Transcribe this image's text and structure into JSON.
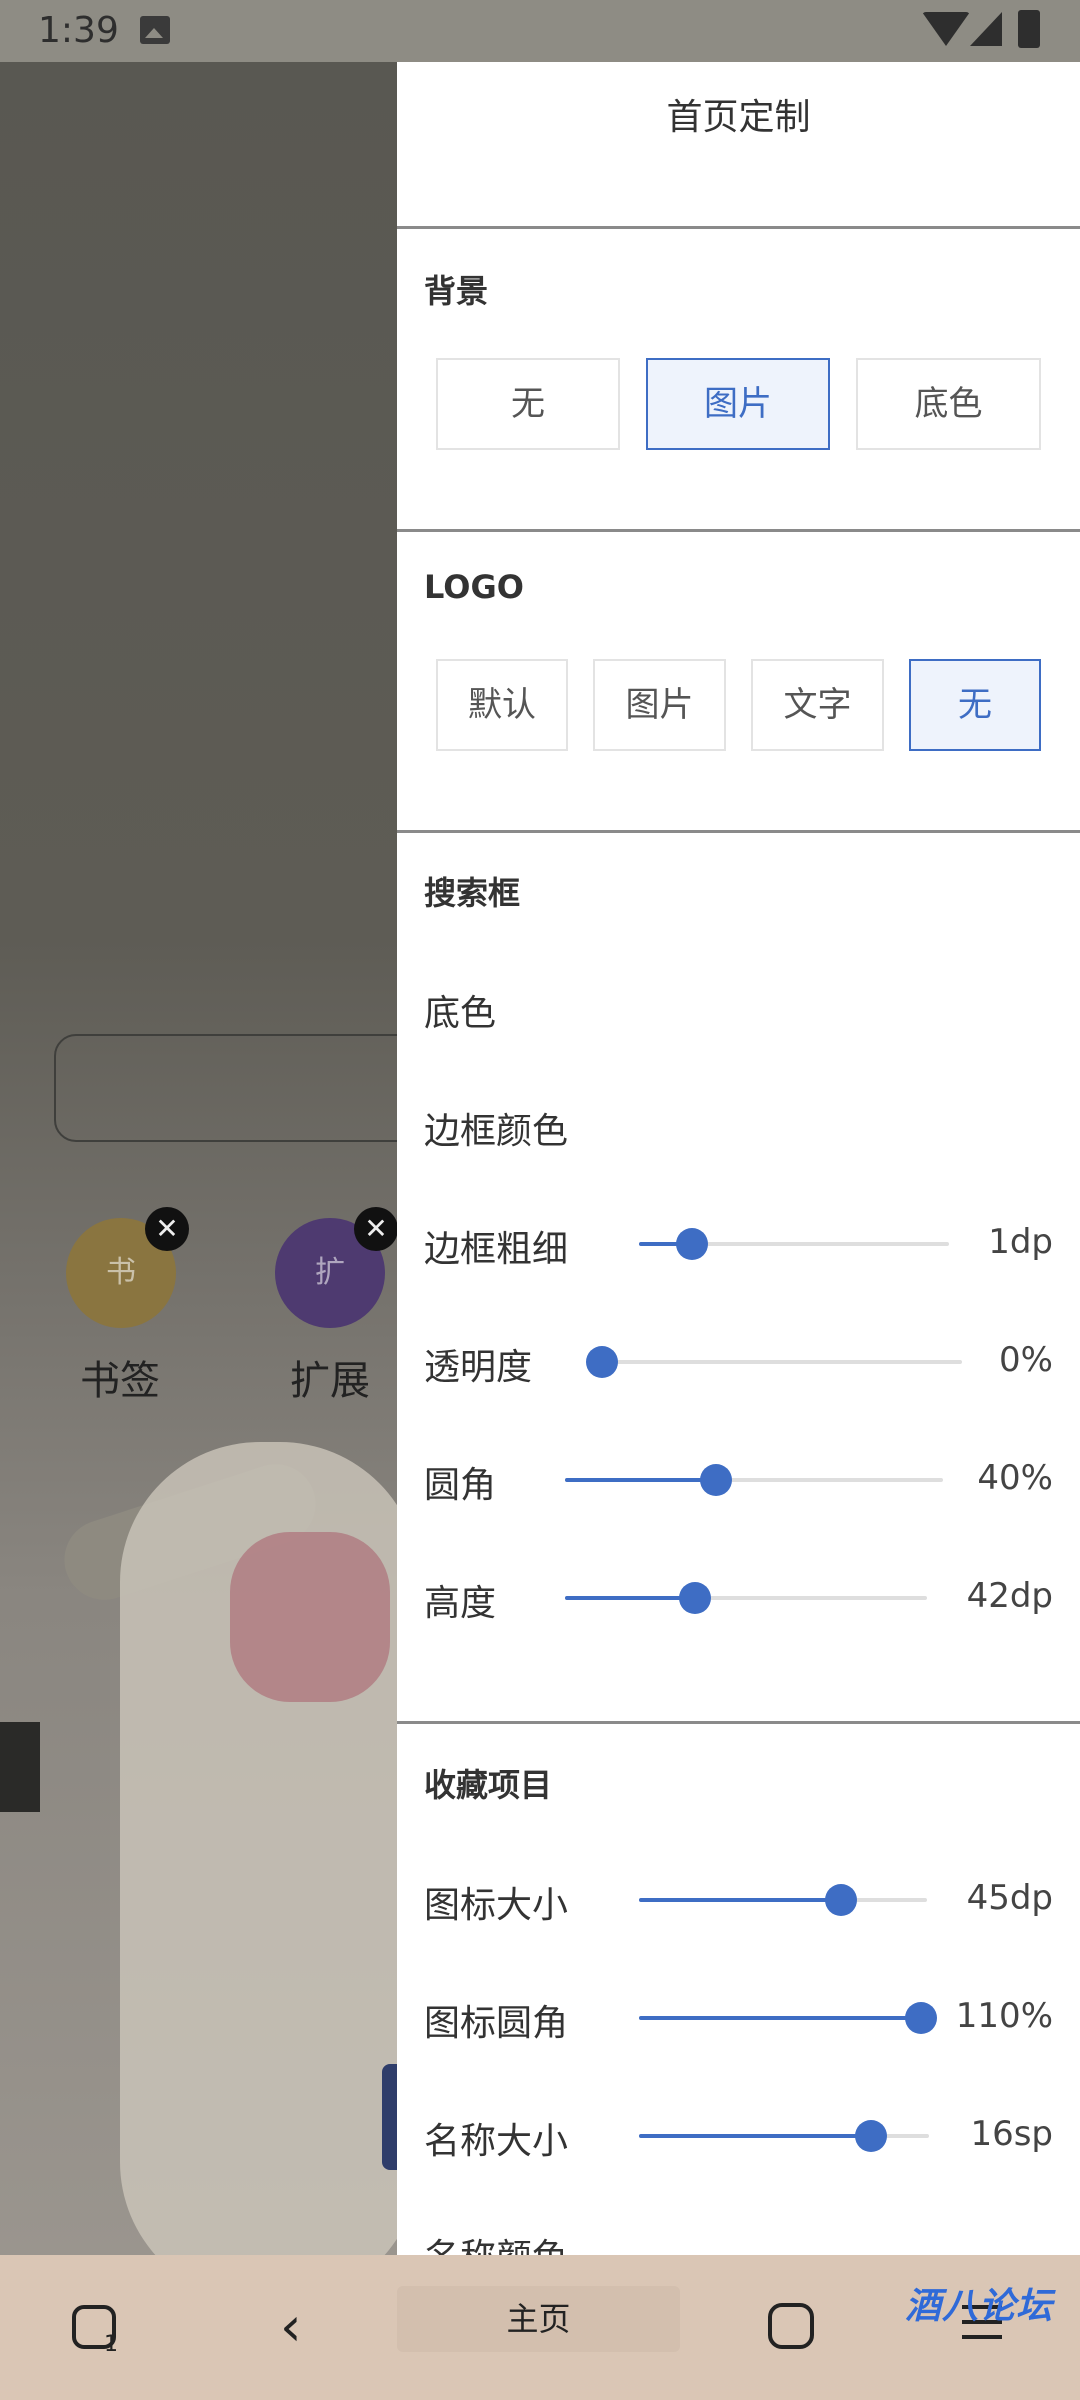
{
  "status_bar": {
    "time": "1:39"
  },
  "background": {
    "favorites": [
      {
        "icon_text": "书",
        "label": "书签"
      },
      {
        "icon_text": "扩",
        "label": "扩展"
      }
    ],
    "close_glyph": "✕"
  },
  "panel": {
    "title": "首页定制",
    "background_section": {
      "title": "背景",
      "options": [
        "无",
        "图片",
        "底色"
      ],
      "selected": "图片"
    },
    "logo_section": {
      "title": "LOGO",
      "options": [
        "默认",
        "图片",
        "文字",
        "无"
      ],
      "selected": "无"
    },
    "search_section": {
      "title": "搜索框",
      "bg_color_label": "底色",
      "border_color_label": "边框颜色",
      "sliders": [
        {
          "label": "边框粗细",
          "value_text": "1dp",
          "fraction": 0.17
        },
        {
          "label": "透明度",
          "value_text": "0%",
          "fraction": 0.0
        },
        {
          "label": "圆角",
          "value_text": "40%",
          "fraction": 0.4
        },
        {
          "label": "高度",
          "value_text": "42dp",
          "fraction": 0.36
        }
      ]
    },
    "favorites_section": {
      "title": "收藏项目",
      "sliders": [
        {
          "label": "图标大小",
          "value_text": "45dp",
          "fraction": 0.7
        },
        {
          "label": "图标圆角",
          "value_text": "110%",
          "fraction": 1.0
        },
        {
          "label": "名称大小",
          "value_text": "16sp",
          "fraction": 0.8
        }
      ],
      "name_color_label": "名称颜色"
    }
  },
  "nav": {
    "tabs_count": "1",
    "back_glyph": "‹",
    "home_label": "主页",
    "watermark": "酒八论坛"
  },
  "colors": {
    "accent": "#3e6dc4",
    "panel_bg": "#ffffff",
    "nav_bg": "#dac6b5"
  }
}
